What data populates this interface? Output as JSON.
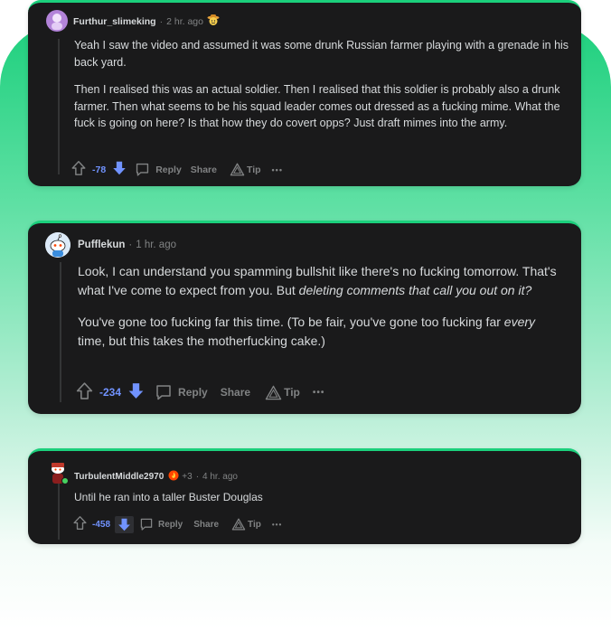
{
  "comments": [
    {
      "username": "Furthur_slimeking",
      "time": "2 hr. ago",
      "flair_icon": "cowboy-emoji-icon",
      "paragraphs": [
        "Yeah I saw the video and assumed it was some drunk Russian farmer playing with a grenade in his back yard.",
        "Then I realised this was an actual soldier. Then I realised that this soldier is probably also a drunk farmer. Then what seems to be his squad leader comes out dressed as a fucking mime. What the fuck is going on here? Is that how they do covert opps? Just draft mimes into the army."
      ],
      "score": "-78",
      "reply_label": "Reply",
      "share_label": "Share",
      "tip_label": "Tip",
      "more_label": "•••"
    },
    {
      "username": "Pufflekun",
      "time": "1 hr. ago",
      "p1_a": "Look, I can understand you spamming bullshit like there's no fucking tomorrow. That's what I've come to expect from you. But ",
      "p1_em": "deleting comments that call you out on it?",
      "p2_a": "You've gone too fucking far this time. (To be fair, you've gone too fucking far ",
      "p2_em": "every",
      "p2_b": " time, but this takes the motherfucking cake.)",
      "score": "-234",
      "reply_label": "Reply",
      "share_label": "Share",
      "tip_label": "Tip",
      "more_label": "•••"
    },
    {
      "username": "TurbulentMiddle2970",
      "karma_badge": "+3",
      "time": "4 hr. ago",
      "text": "Until he ran into a taller Buster Douglas",
      "score": "-458",
      "reply_label": "Reply",
      "share_label": "Share",
      "tip_label": "Tip",
      "more_label": "•••"
    }
  ],
  "colors": {
    "card_bg": "#1a1a1b",
    "accent_green": "#1bd07c",
    "downvote_blue": "#7193ff",
    "meta_gray": "#818384",
    "text": "#d7dadc"
  }
}
